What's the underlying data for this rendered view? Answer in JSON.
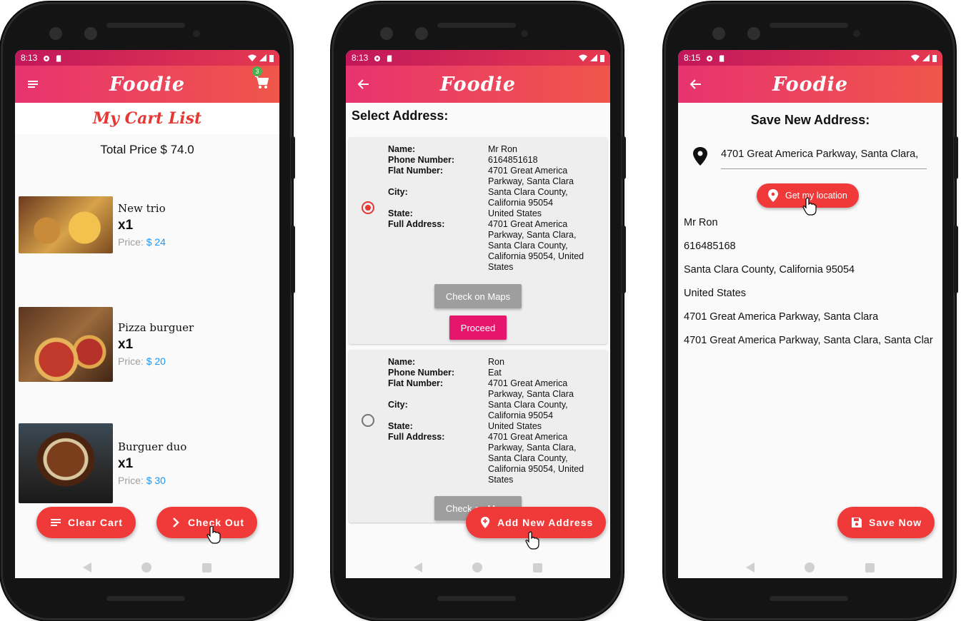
{
  "app": {
    "title": "Foodie",
    "accent": "#f03a3a"
  },
  "screen1": {
    "status_time": "8:13",
    "cart_badge": "3",
    "page_title": "My Cart List",
    "total": "Total Price $ 74.0",
    "price_label": "Price:",
    "items": [
      {
        "name": "New trio",
        "qty": "x1",
        "price": "$ 24"
      },
      {
        "name": "Pizza burguer",
        "qty": "x1",
        "price": "$ 20"
      },
      {
        "name": "Burguer duo",
        "qty": "x1",
        "price": "$ 30"
      }
    ],
    "clear_label": "Clear Cart",
    "checkout_label": "Check Out"
  },
  "screen2": {
    "status_time": "8:13",
    "heading": "Select Address:",
    "labels": {
      "name": "Name:",
      "phone": "Phone Number:",
      "flat": "Flat Number:",
      "city": "City:",
      "state": "State:",
      "full": "Full Address:"
    },
    "addresses": [
      {
        "selected": true,
        "name": "Mr Ron",
        "phone": "6164851618",
        "flat": "4701 Great America Parkway,  Santa Clara",
        "city": "Santa Clara County, California 95054",
        "state": "United States",
        "full": "4701 Great America Parkway,  Santa Clara, Santa Clara County, California 95054, United States"
      },
      {
        "selected": false,
        "name": "Ron",
        "phone": "Eat",
        "flat": "4701 Great America Parkway,  Santa Clara",
        "city": "Santa Clara County, California 95054",
        "state": "United States",
        "full": "4701 Great America Parkway,  Santa Clara, Santa Clara County, California 95054, United States"
      }
    ],
    "maps_label": "Check on Maps",
    "proceed_label": "Proceed",
    "add_label": "Add New Address"
  },
  "screen3": {
    "status_time": "8:15",
    "heading": "Save New Address:",
    "address_value": "4701 Great America Parkway,  Santa Clara,",
    "location_label": "Get my location",
    "lines": [
      "Mr Ron",
      "616485168",
      "Santa Clara County, California 95054",
      "United States",
      "4701 Great America Parkway,  Santa Clara",
      "4701 Great America Parkway,  Santa Clara, Santa Clar"
    ],
    "save_label": "Save Now"
  }
}
